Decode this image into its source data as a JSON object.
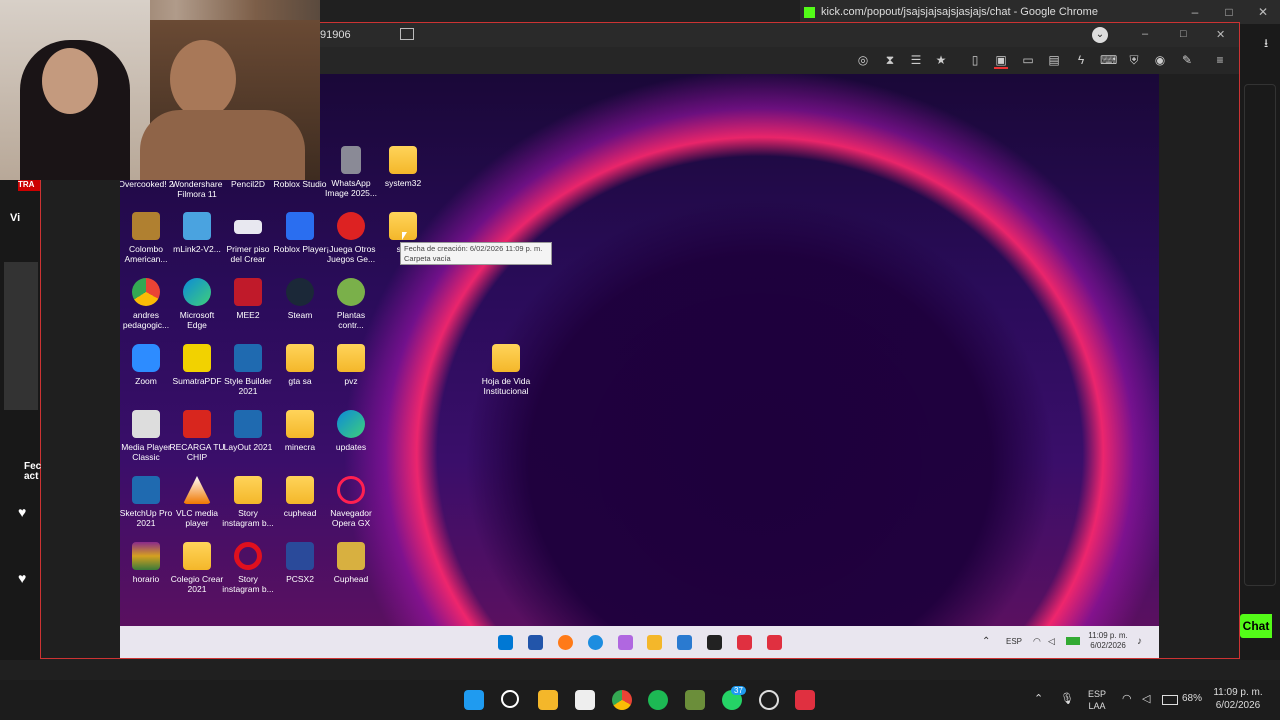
{
  "chrome_window": {
    "title": "kick.com/popout/jsajsjajsajsjasjajs/chat - Google Chrome",
    "minimize": "–",
    "maximize": "□",
    "close": "✕"
  },
  "remote_session": {
    "title_fragment": "91906",
    "minimize": "–",
    "maximize": "□",
    "close": "✕"
  },
  "left_panel": {
    "badge": "TRA",
    "view_label": "Vi",
    "notice": "Fec\nact"
  },
  "desktop_icons": [
    {
      "label": "Overcooked! 2",
      "icon": "game-icon"
    },
    {
      "label": "Wondershare Filmora 11",
      "icon": "filmora-icon"
    },
    {
      "label": "Pencil2D",
      "icon": "pencil-icon"
    },
    {
      "label": "Roblox Studio",
      "icon": "roblox-studio-icon"
    },
    {
      "label": "WhatsApp Image 2025...",
      "icon": "image-icon"
    },
    {
      "label": "system32",
      "icon": "folder-icon"
    },
    {
      "label": "Colombo American...",
      "icon": "folder-icon"
    },
    {
      "label": "mLink2-V2...",
      "icon": "mlink-icon"
    },
    {
      "label": "Primer piso del Crear",
      "icon": "image-icon"
    },
    {
      "label": "Roblox Player",
      "icon": "roblox-icon"
    },
    {
      "label": "¡Juega Otros Juegos Ge...",
      "icon": "popcap-icon"
    },
    {
      "label": "sys",
      "icon": "folder-icon"
    },
    {
      "label": "andres pedagogic...",
      "icon": "chrome-icon"
    },
    {
      "label": "Microsoft Edge",
      "icon": "edge-icon"
    },
    {
      "label": "MEE2",
      "icon": "mee-icon"
    },
    {
      "label": "Steam",
      "icon": "steam-icon"
    },
    {
      "label": "Plantas contr...",
      "icon": "pvz-icon"
    },
    {
      "label": "Zoom",
      "icon": "zoom-icon"
    },
    {
      "label": "SumatraPDF",
      "icon": "pdf-icon"
    },
    {
      "label": "Style Builder 2021",
      "icon": "sketchup-icon"
    },
    {
      "label": "gta sa",
      "icon": "folder-icon"
    },
    {
      "label": "pvz",
      "icon": "folder-icon"
    },
    {
      "label": "Hoja de Vida Institucional",
      "icon": "folder-icon"
    },
    {
      "label": "Media Player Classic",
      "icon": "mpc-icon"
    },
    {
      "label": "RECARGA TU CHIP",
      "icon": "pdf-icon"
    },
    {
      "label": "LayOut 2021",
      "icon": "sketchup-icon"
    },
    {
      "label": "minecra",
      "icon": "folder-icon"
    },
    {
      "label": "updates",
      "icon": "edge-icon"
    },
    {
      "label": "SketchUp Pro 2021",
      "icon": "sketchup-icon"
    },
    {
      "label": "VLC media player",
      "icon": "vlc-icon"
    },
    {
      "label": "Story instagram b...",
      "icon": "folder-icon"
    },
    {
      "label": "cuphead",
      "icon": "folder-icon"
    },
    {
      "label": "Navegador Opera GX",
      "icon": "opera-gx-icon"
    },
    {
      "label": "horario",
      "icon": "winrar-icon"
    },
    {
      "label": "Colegio Crear 2021",
      "icon": "folder-icon"
    },
    {
      "label": "Story instagram b...",
      "icon": "opera-icon"
    },
    {
      "label": "PCSX2",
      "icon": "pcsx2-icon"
    },
    {
      "label": "Cuphead",
      "icon": "cuphead-icon"
    }
  ],
  "tooltip": {
    "line1": "Fecha de creación: 6/02/2026 11:09 p. m.",
    "line2": "Carpeta vacía"
  },
  "remote_taskbar": {
    "lang": "ESP",
    "time": "11:09 p. m.",
    "date": "6/02/2026"
  },
  "host_taskbar": {
    "whatsapp_badge": "37",
    "lang_line1": "ESP",
    "lang_line2": "LAA",
    "battery": "68%",
    "time": "11:09 p. m.",
    "date": "6/02/2026"
  },
  "chat_button": "Chat",
  "colors": {
    "kick_green": "#53fc18",
    "remote_border": "#cc3333",
    "folder": "#f4b72a"
  }
}
